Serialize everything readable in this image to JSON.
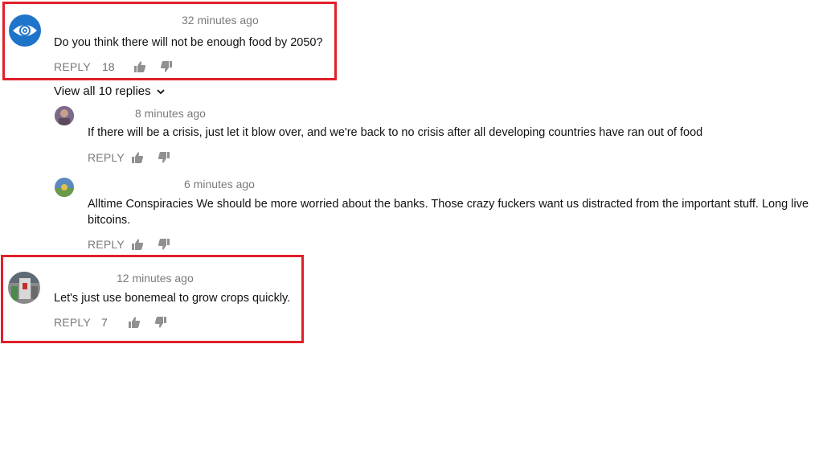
{
  "highlight_color": "#e0202a",
  "thread": {
    "comment1": {
      "time": "32 minutes ago",
      "text": "Do you think there will not be enough food by 2050?",
      "reply_label": "REPLY",
      "likes": "18",
      "avatar_icon": "eye-avatar-icon"
    },
    "view_replies": {
      "label": "View all 10 replies",
      "icon": "chevron-down-icon"
    },
    "replies": [
      {
        "time": "8 minutes ago",
        "text": "If there will be a crisis, just let it blow over, and we're back to no crisis after all developing countries have ran out of food",
        "reply_label": "REPLY"
      },
      {
        "time": "6 minutes ago",
        "text": "Alltime Conspiracies We should be more worried about the banks. Those crazy fuckers want us distracted from the important stuff. Long live bitcoins.",
        "reply_label": "REPLY"
      }
    ],
    "comment2": {
      "time": "12 minutes ago",
      "text": "Let's just use bonemeal to grow crops quickly.",
      "reply_label": "REPLY",
      "likes": "7"
    }
  }
}
